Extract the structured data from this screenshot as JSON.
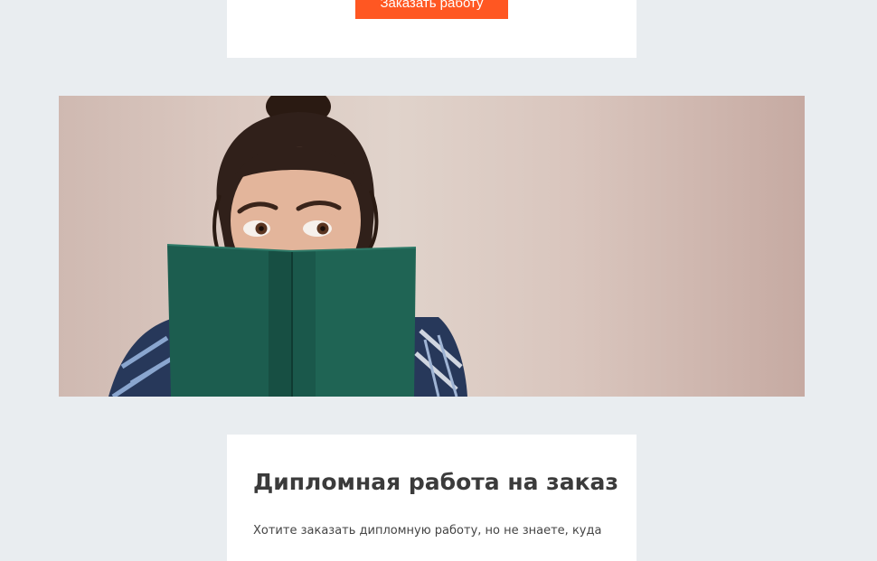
{
  "top_card": {
    "order_button_label": "Заказать работу"
  },
  "hero": {
    "image_alt": "Девушка выглядывает из-за зелёной книги"
  },
  "article": {
    "title": "Дипломная работа на заказ",
    "intro": "Хотите заказать дипломную работу, но не знаете, куда"
  },
  "colors": {
    "accent": "#ff5722",
    "page_bg": "#e9edf0",
    "card_bg": "#ffffff",
    "title": "#3b3b3b"
  }
}
